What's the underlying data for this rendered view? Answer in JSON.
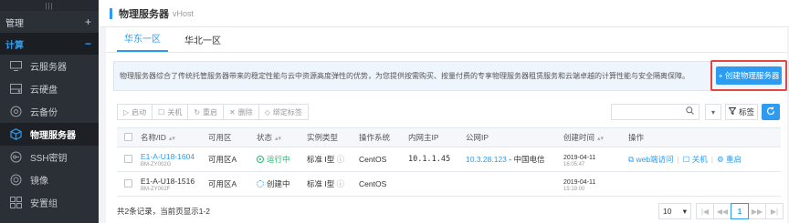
{
  "sidebar": {
    "grip": "|||",
    "sections": [
      {
        "label": "管理",
        "sign": "+"
      },
      {
        "label": "计算",
        "sign": "−"
      }
    ],
    "items": [
      {
        "label": "云服务器",
        "icon": "monitor-icon"
      },
      {
        "label": "云硬盘",
        "icon": "disk-icon"
      },
      {
        "label": "云备份",
        "icon": "backup-icon"
      },
      {
        "label": "物理服务器",
        "icon": "cube-icon"
      },
      {
        "label": "SSH密钥",
        "icon": "key-icon"
      },
      {
        "label": "镜像",
        "icon": "image-icon"
      },
      {
        "label": "安置组",
        "icon": "group-icon"
      }
    ]
  },
  "header": {
    "title": "物理服务器",
    "subtitle": "vHost"
  },
  "tabs": [
    {
      "label": "华东一区"
    },
    {
      "label": "华北一区"
    }
  ],
  "notice": "物理服务器综合了传统托管服务器带来的稳定性能与云中资源高度弹性的优势，为您提供按需购买、按量付费的专享物理服务器租赁服务和云端卓越的计算性能与安全隔离保障。",
  "create_button": "+ 创建物理服务器",
  "toolbar": {
    "start": "启动",
    "shutdown": "关机",
    "restart": "重启",
    "delete": "删除",
    "bind_tag": "绑定标签",
    "tag_filter": "标签"
  },
  "table": {
    "headers": {
      "name": "名称/ID",
      "zone": "可用区",
      "status": "状态",
      "type": "实例类型",
      "os": "操作系统",
      "private_ip": "内网主IP",
      "public_ip": "公网IP",
      "created": "创建时间",
      "ops": "操作"
    },
    "rows": [
      {
        "name": "E1-A-U18-1604",
        "id": "BM-ZY002G",
        "zone": "可用区A",
        "status": "运行中",
        "type": "标准 I型",
        "os": "CentOS",
        "private_ip": "10.1.1.45",
        "public_ip": "10.3.28.123",
        "isp": " - 中国电信",
        "date": "2019-04-11",
        "time": "16:05:47",
        "op_web": "web端访问",
        "op_shutdown": "关机",
        "op_restart": "重启"
      },
      {
        "name": "E1-A-U18-1516",
        "id": "BM-ZY002F",
        "zone": "可用区A",
        "status": "创建中",
        "type": "标准 I型",
        "os": "CentOS",
        "private_ip": "",
        "public_ip": "",
        "isp": "",
        "date": "2019-04-11",
        "time": "15:19:00"
      }
    ]
  },
  "footer": {
    "summary": "共2条记录，当前页显示1-2",
    "page_size": "10",
    "current_page": "1",
    "first": "|◀",
    "prev": "◀◀",
    "next": "▶▶",
    "last": "▶|"
  },
  "colors": {
    "accent": "#2d9cf0",
    "running": "#19be6b",
    "highlight": "#e3473c",
    "sidebar": "#2b2f36"
  }
}
